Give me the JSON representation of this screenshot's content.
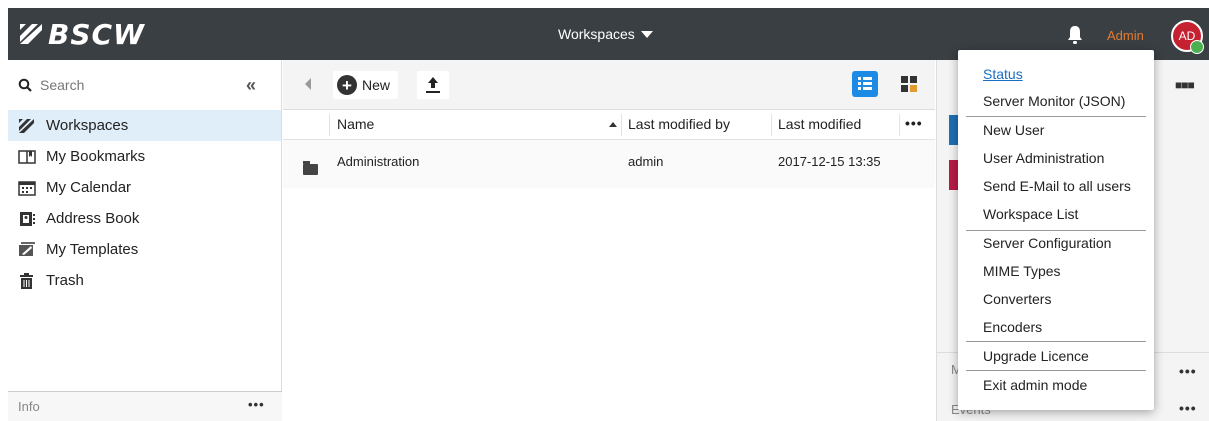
{
  "app": {
    "logo_text": "BSCW"
  },
  "header": {
    "workspaces_menu": "Workspaces",
    "admin_label": "Admin",
    "avatar_initials": "AD"
  },
  "sidebar": {
    "search_label": "Search",
    "collapse": "«",
    "items": [
      {
        "label": "Workspaces",
        "icon": "workspaces-icon",
        "active": true
      },
      {
        "label": "My Bookmarks",
        "icon": "bookmarks-icon"
      },
      {
        "label": "My Calendar",
        "icon": "calendar-icon"
      },
      {
        "label": "Address Book",
        "icon": "address-book-icon"
      },
      {
        "label": "My Templates",
        "icon": "templates-icon"
      },
      {
        "label": "Trash",
        "icon": "trash-icon"
      }
    ],
    "info_label": "Info",
    "info_dots": "•••"
  },
  "toolbar": {
    "new_label": "New"
  },
  "table": {
    "columns": [
      "Name",
      "Last modified by",
      "Last modified"
    ],
    "more": "•••",
    "rows": [
      {
        "name": "Administration",
        "modified_by": "admin",
        "modified": "2017-12-15 13:35"
      }
    ]
  },
  "right_panel": {
    "m_label": "M",
    "events_label": "Events",
    "dots": "•••"
  },
  "admin_menu": {
    "items": [
      "Status",
      "Server Monitor (JSON)",
      "New User",
      "User Administration",
      "Send E-Mail to all users",
      "Workspace List",
      "Server Configuration",
      "MIME Types",
      "Converters",
      "Encoders",
      "Upgrade Licence",
      "Exit admin mode"
    ]
  },
  "colors": {
    "topbar": "#3a3f44",
    "accent": "#1d8ae6",
    "admin": "#e37b2f",
    "avatar": "#c62131",
    "active_row": "#e0eefa"
  }
}
